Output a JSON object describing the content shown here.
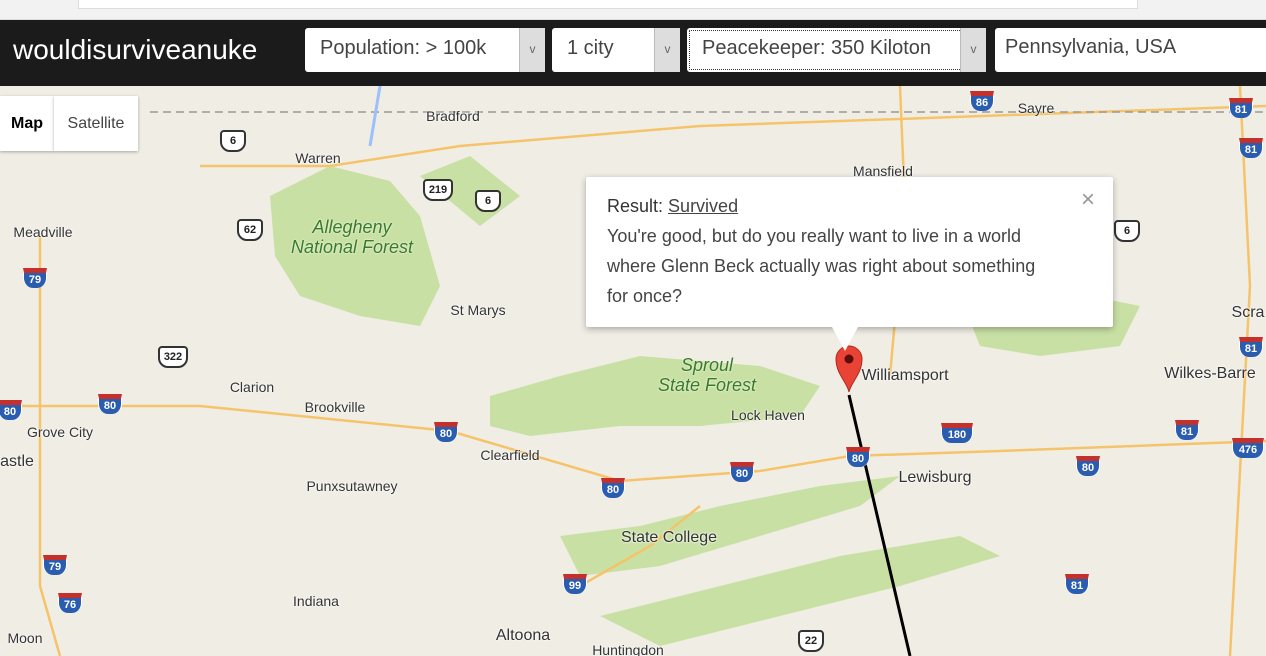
{
  "header": {
    "brand": "wouldisurviveanuke",
    "population": "Population: > 100k",
    "cities": "1 city",
    "weapon": "Peacekeeper: 350 Kiloton",
    "location": "Pennsylvania, USA",
    "dropdown_arrow": "v"
  },
  "map": {
    "type_controls": [
      "Map",
      "Satellite"
    ],
    "places": [
      "Bradford",
      "Warren",
      "Mansfield",
      "Sayre",
      "Meadville",
      "St Marys",
      "Clarion",
      "Brookville",
      "Grove City",
      "astle",
      "Clearfield",
      "Lock Haven",
      "Williamsport",
      "Lewisburg",
      "Wilkes-Barre",
      "Scra",
      "Punxsutawney",
      "State College",
      "Indiana",
      "Altoona",
      "Huntingdon",
      "Moon"
    ],
    "forests": [
      [
        "Allegheny",
        "National Forest"
      ],
      [
        "Sproul",
        "State Forest"
      ]
    ],
    "interstates": [
      "86",
      "81",
      "81",
      "79",
      "80",
      "80",
      "80",
      "80",
      "80",
      "80",
      "180",
      "80",
      "81",
      "476",
      "79",
      "76",
      "99",
      "81",
      "81"
    ],
    "us_routes": [
      "6",
      "219",
      "6",
      "62",
      "322",
      "6",
      "22"
    ],
    "marker_color": "#e94335"
  },
  "infowindow": {
    "result_label": "Result:",
    "result_value": "Survived",
    "message": "You're good, but do you really want to live in a world where Glenn Beck actually was right about something for once?",
    "close": "×"
  }
}
